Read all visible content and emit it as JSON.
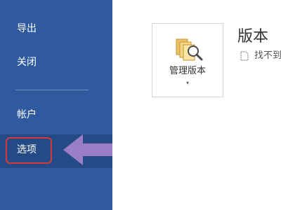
{
  "sidebar": {
    "items": [
      {
        "label": "导出"
      },
      {
        "label": "关闭"
      },
      {
        "label": "帐户"
      },
      {
        "label": "选项"
      }
    ]
  },
  "main": {
    "manage_versions_label": "管理版本",
    "caret": "▾",
    "section_title": "版本",
    "version_info": "找不到以前的版本"
  },
  "colors": {
    "sidebar_bg": "#2f5a9f",
    "selected_bg": "#244b85",
    "highlight_border": "#d63a3a",
    "arrow_color": "#9b7ec5"
  }
}
